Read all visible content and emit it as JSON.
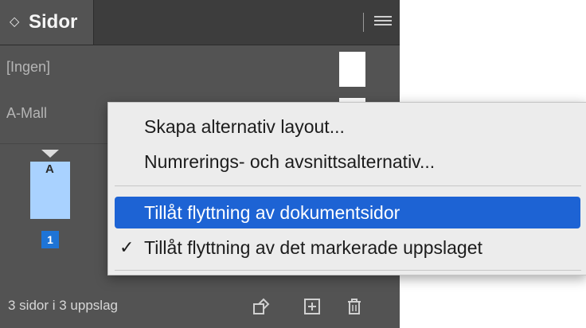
{
  "panel": {
    "tab_chevron": "◇",
    "tab_title": "Sidor",
    "masters": [
      {
        "label": "[Ingen]"
      },
      {
        "label": "A-Mall"
      }
    ],
    "page": {
      "master_letter": "A",
      "number": "1"
    },
    "status": "3 sidor i 3 uppslag",
    "footer_icons": [
      "edit-page-size-icon",
      "new-page-icon",
      "trash-icon"
    ]
  },
  "context_menu": {
    "items": [
      {
        "label": "Skapa alternativ layout...",
        "checked": false,
        "selected": false
      },
      {
        "label": "Numrerings- och avsnittsalternativ...",
        "checked": false,
        "selected": false
      },
      {
        "label": "Tillåt flyttning av dokumentsidor",
        "checked": false,
        "selected": true
      },
      {
        "label": "Tillåt flyttning av det markerade uppslaget",
        "checked": true,
        "selected": false
      }
    ],
    "check_mark": "✓"
  },
  "colors": {
    "panel_bg": "#535353",
    "menu_bg": "#ececec",
    "highlight": "#1d63d4",
    "page_thumb": "#a9d2ff"
  }
}
